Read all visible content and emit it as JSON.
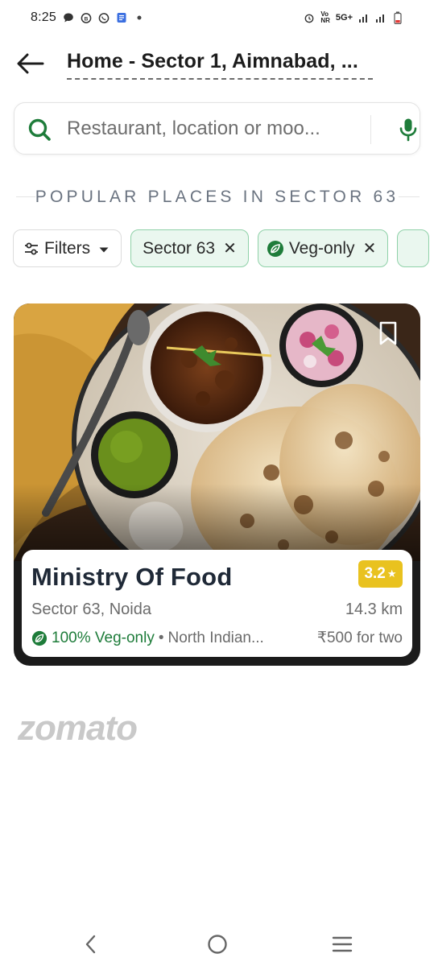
{
  "status_bar": {
    "time": "8:25",
    "left_icons": [
      "chat-bubble-icon",
      "whatsapp-business-icon",
      "whatsapp-icon",
      "docs-icon",
      "dot-icon"
    ],
    "network_label_top": "Vo",
    "network_label_bottom": "NR",
    "network_type": "5G+",
    "right_icons": [
      "alarm-icon",
      "signal-icon",
      "signal-icon",
      "battery-low-icon"
    ]
  },
  "header": {
    "location": "Home - Sector 1, Aimnabad, ..."
  },
  "search": {
    "placeholder": "Restaurant, location or moo..."
  },
  "section": {
    "heading": "POPULAR PLACES IN SECTOR 63"
  },
  "filters": {
    "filters_label": "Filters",
    "chips": [
      {
        "label": "Sector 63",
        "active": true,
        "closable": true
      },
      {
        "label": "Veg-only",
        "active": true,
        "closable": true,
        "icon": "leaf-icon"
      }
    ]
  },
  "restaurant": {
    "name": "Ministry Of Food",
    "rating": "3.2",
    "locality": "Sector 63, Noida",
    "distance": "14.3 km",
    "veg_label": "100% Veg-only",
    "separator": "•",
    "cuisine": "North Indian...",
    "price": "₹500 for two"
  },
  "brand": {
    "logo": "zomato"
  },
  "colors": {
    "accent_green": "#1e7c3a",
    "chip_active_bg": "#eaf7ef",
    "rating_yellow": "#e9c21f"
  }
}
